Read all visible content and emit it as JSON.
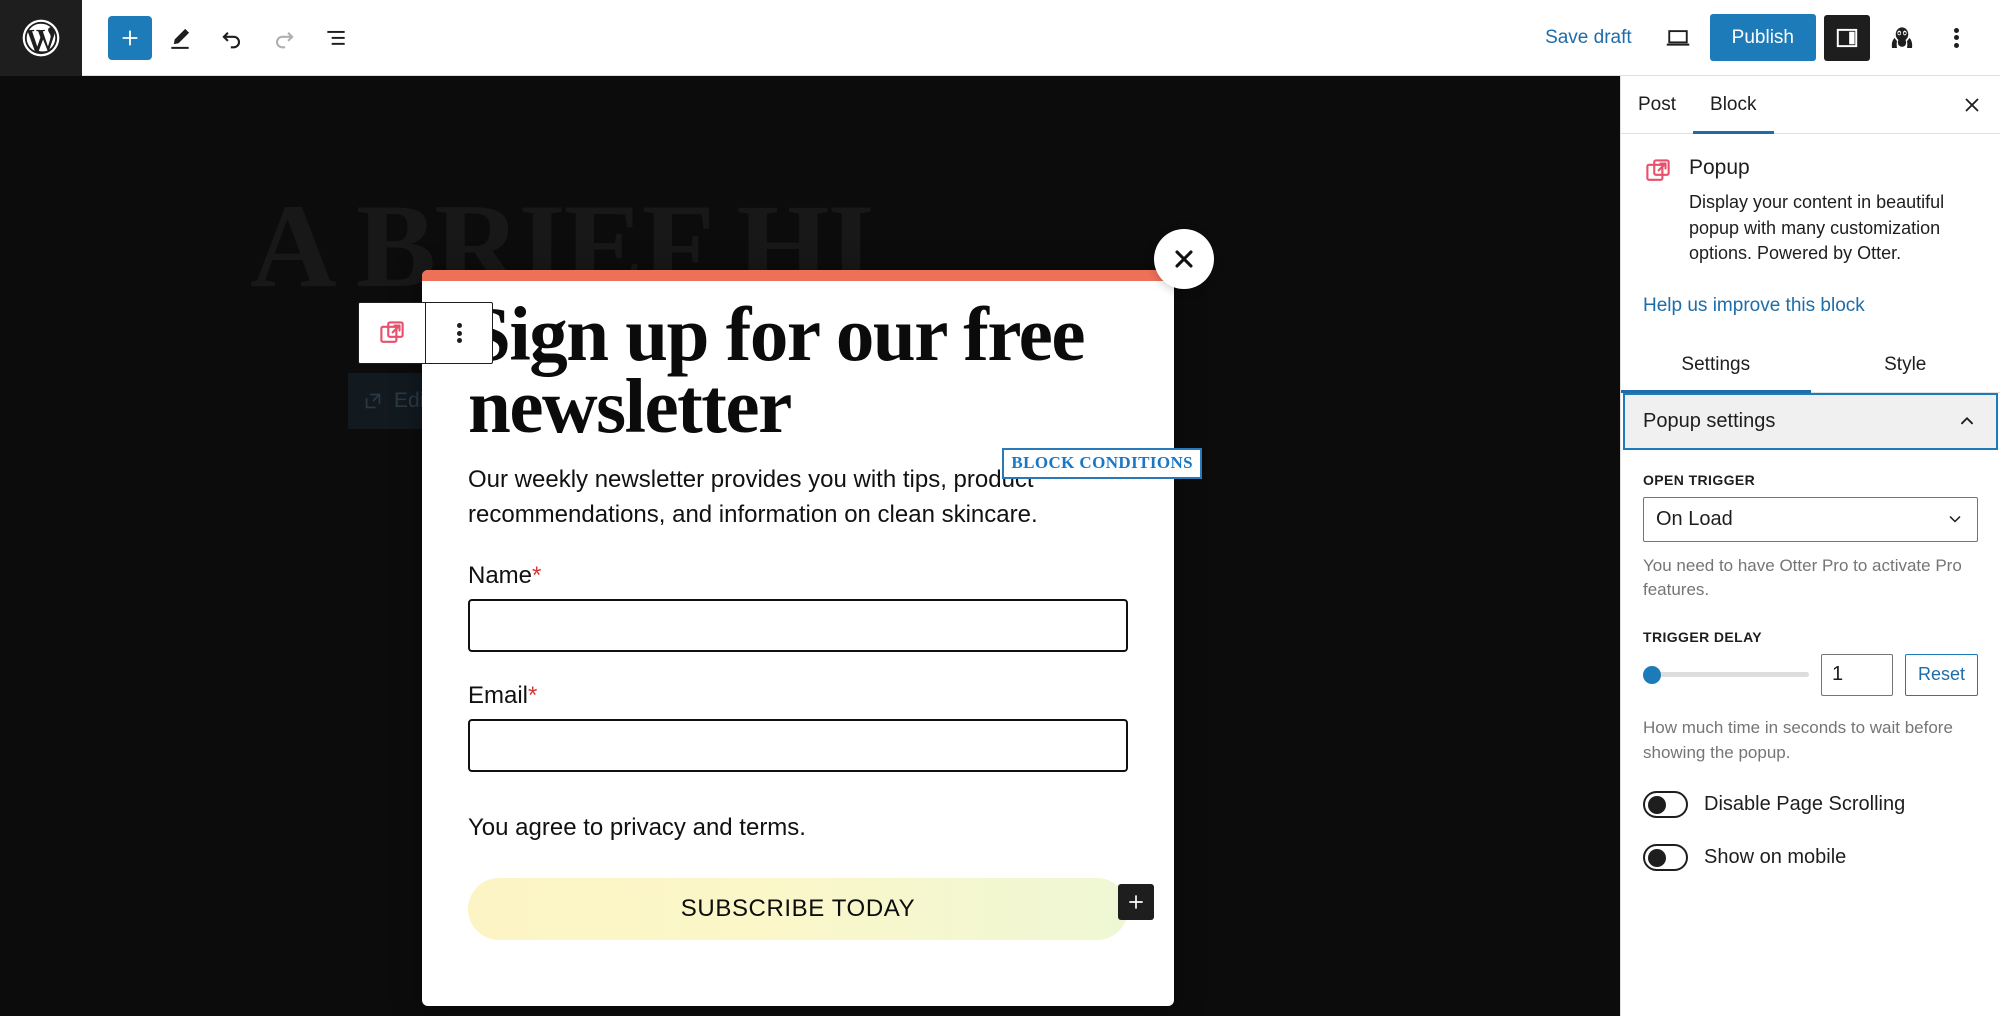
{
  "topbar": {
    "logo_icon": "wordpress-logo-icon",
    "add_block_label": "+",
    "tools_icon": "pencil-tools-icon",
    "undo_icon": "undo-arrow-icon",
    "redo_icon": "redo-arrow-icon",
    "list_view_icon": "document-outline-icon",
    "save_draft_label": "Save draft",
    "preview_icon": "laptop-preview-icon",
    "publish_label": "Publish",
    "sidebar_toggle_icon": "sidebar-panel-icon",
    "avatar_icon": "jetpack-avatar-icon",
    "options_icon": "kebab-menu-icon"
  },
  "canvas": {
    "ghost_heading": "A BRIEF HI",
    "ghost_edit_label": "Edit",
    "ghost_edit_icon": "external-link-icon",
    "background_color": "#0c0c0c"
  },
  "block_toolbar": {
    "popup_block_icon": "popup-external-link-icon",
    "more_options_icon": "vertical-kebab-icon"
  },
  "popup": {
    "accent_bar_color": "#ef7059",
    "close_icon": "close-x-icon",
    "heading": "Sign up for our free newsletter",
    "description": "Our weekly newsletter provides you with tips, product recommendations, and information on clean skincare.",
    "block_conditions_badge": "BLOCK CONDITIONS",
    "fields": [
      {
        "label": "Name",
        "required_mark": "*",
        "value": "",
        "placeholder": ""
      },
      {
        "label": "Email",
        "required_mark": "*",
        "value": "",
        "placeholder": ""
      }
    ],
    "consent_text": "You agree to privacy and terms.",
    "submit_label": "SUBSCRIBE TODAY",
    "submit_gradient_from": "#fcf4c4",
    "submit_gradient_to": "#eef7d4",
    "add_block_icon": "plus-icon"
  },
  "sidebar": {
    "tabs": [
      {
        "label": "Post",
        "active": false
      },
      {
        "label": "Block",
        "active": true
      }
    ],
    "close_icon": "close-x-icon",
    "block": {
      "icon": "popup-external-link-icon",
      "name": "Popup",
      "description": "Display your content in beautiful popup with many customization options. Powered by Otter."
    },
    "help_link": "Help us improve this block",
    "subtabs": [
      {
        "label": "Settings",
        "active": true
      },
      {
        "label": "Style",
        "active": false
      }
    ],
    "panel": {
      "title": "Popup settings",
      "collapse_icon": "chevron-up-icon",
      "open_trigger": {
        "label": "OPEN TRIGGER",
        "value": "On Load",
        "chevron_icon": "chevron-down-icon",
        "help": "You need to have Otter Pro to activate Pro features."
      },
      "trigger_delay": {
        "label": "TRIGGER DELAY",
        "value": "1",
        "slider_percent": 0,
        "reset_label": "Reset",
        "help": "How much time in seconds to wait before showing the popup."
      },
      "toggles": [
        {
          "label": "Disable Page Scrolling",
          "on": false
        },
        {
          "label": "Show on mobile",
          "on": false
        }
      ]
    },
    "accent_color": "#1e7bb9"
  }
}
